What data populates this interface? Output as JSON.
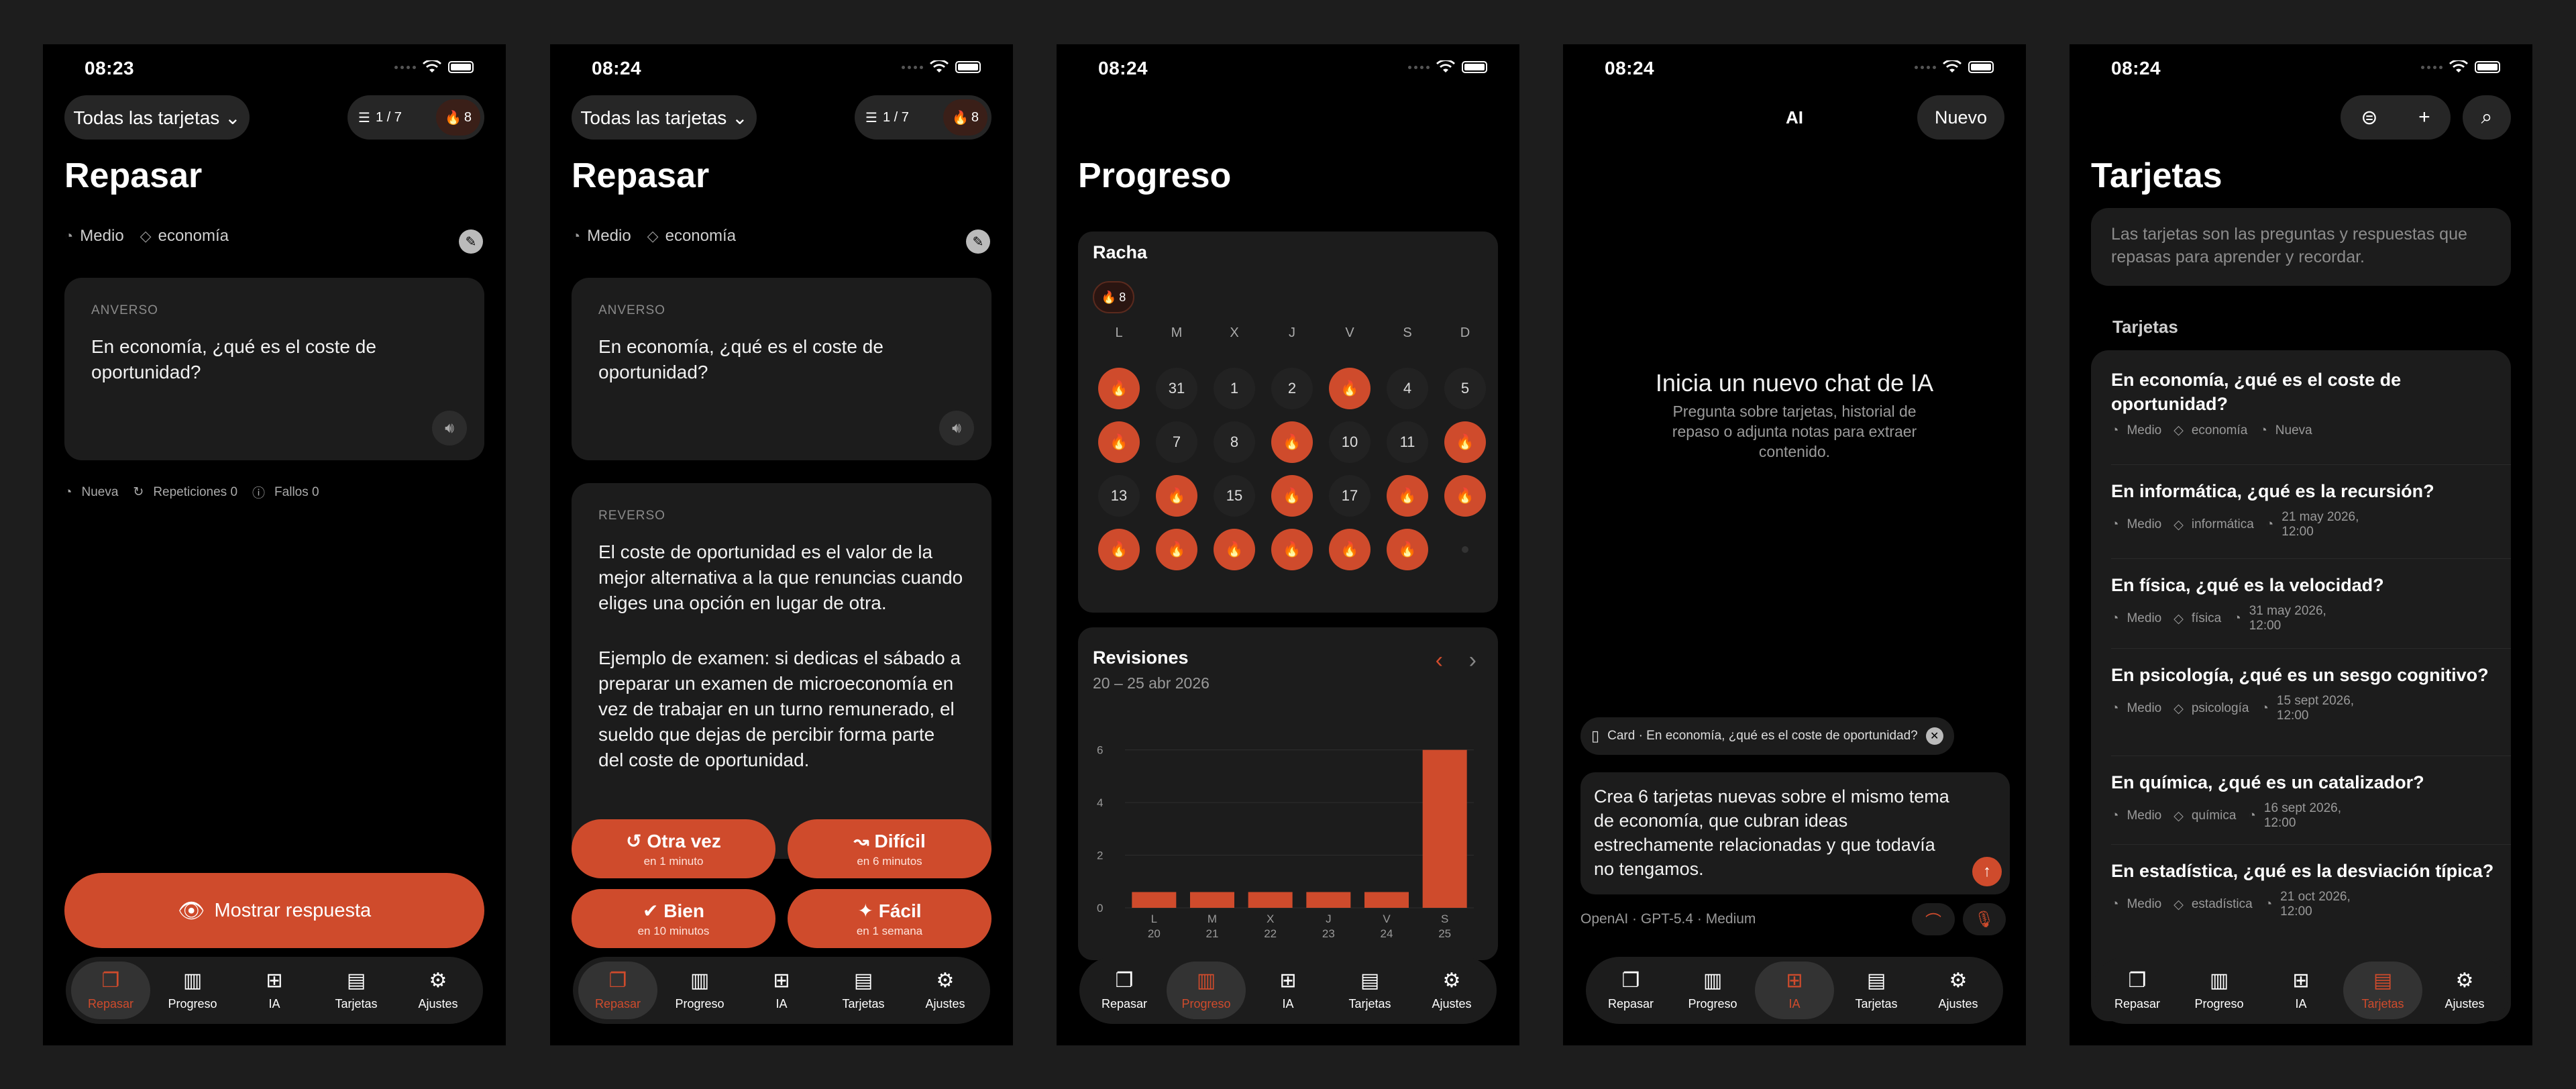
{
  "status": {
    "time1": "08:23",
    "time2": "08:24",
    "time3": "08:24",
    "time4": "08:24",
    "time5": "08:24"
  },
  "review": {
    "filter": "Todas las tarjetas ⌄",
    "count": "1 / 7",
    "streak": "8",
    "title": "Repasar",
    "difficulty": "Medio",
    "tag": "economía",
    "front_label": "ANVERSO",
    "question": "En economía, ¿qué es el coste de oportunidad?",
    "stats": {
      "state": "Nueva",
      "reps": "Repeticiones 0",
      "fails": "Fallos 0"
    },
    "show_answer": "Mostrar respuesta",
    "back_label": "REVERSO",
    "answer_p1": "El coste de oportunidad es el valor de la mejor alternativa a la que renuncias cuando eliges una opción en lugar de otra.",
    "answer_p2": "Ejemplo de examen: si dedicas el sábado a preparar un examen de microeconomía en vez de trabajar en un turno remunerado, el sueldo que dejas de percibir forma parte del coste de oportunidad.",
    "ai_badge": "AI",
    "buttons": [
      {
        "label": "Otra vez",
        "sub": "en 1 minuto",
        "icon": "↺"
      },
      {
        "label": "Difícil",
        "sub": "en 6 minutos",
        "icon": "↝"
      },
      {
        "label": "Bien",
        "sub": "en 10 minutos",
        "icon": "✔"
      },
      {
        "label": "Fácil",
        "sub": "en 1 semana",
        "icon": "✦"
      }
    ]
  },
  "progress": {
    "title": "Progreso",
    "streak_title": "Racha",
    "streak": "8",
    "weekdays": [
      "L",
      "M",
      "X",
      "J",
      "V",
      "S",
      "D"
    ],
    "weeks": [
      [
        {
          "d": "",
          "f": true
        },
        {
          "d": "31",
          "f": false
        },
        {
          "d": "1",
          "f": false
        },
        {
          "d": "2",
          "f": false
        },
        {
          "d": "",
          "f": true
        },
        {
          "d": "4",
          "f": false
        },
        {
          "d": "5",
          "f": false
        }
      ],
      [
        {
          "d": "",
          "f": true
        },
        {
          "d": "7",
          "f": false
        },
        {
          "d": "8",
          "f": false
        },
        {
          "d": "",
          "f": true
        },
        {
          "d": "10",
          "f": false
        },
        {
          "d": "11",
          "f": false
        },
        {
          "d": "",
          "f": true
        }
      ],
      [
        {
          "d": "13",
          "f": false
        },
        {
          "d": "",
          "f": true
        },
        {
          "d": "15",
          "f": false
        },
        {
          "d": "",
          "f": true
        },
        {
          "d": "17",
          "f": false
        },
        {
          "d": "",
          "f": true
        },
        {
          "d": "",
          "f": true
        }
      ],
      [
        {
          "d": "",
          "f": true
        },
        {
          "d": "",
          "f": true
        },
        {
          "d": "",
          "f": true
        },
        {
          "d": "",
          "f": true
        },
        {
          "d": "",
          "f": true
        },
        {
          "d": "",
          "f": true
        },
        {
          "d": "",
          "f": false
        }
      ]
    ],
    "revisions_title": "Revisiones",
    "range": "20 – 25 abr 2026"
  },
  "chart_data": {
    "type": "bar",
    "title": "Revisiones",
    "categories": [
      "L 20",
      "M 21",
      "X 22",
      "J 23",
      "V 24",
      "S 25"
    ],
    "x_letters": [
      "L",
      "M",
      "X",
      "J",
      "V",
      "S"
    ],
    "x_numbers": [
      "20",
      "21",
      "22",
      "23",
      "24",
      "25"
    ],
    "values": [
      0.6,
      0.6,
      0.6,
      0.6,
      0.6,
      6
    ],
    "yticks": [
      "0",
      "2",
      "4",
      "6"
    ],
    "ylim": [
      0,
      6.5
    ],
    "grid": true,
    "bar_color": "#cf4b2c"
  },
  "ai": {
    "title": "AI",
    "new_btn": "Nuevo",
    "empty_title": "Inicia un nuevo chat de IA",
    "empty_sub": "Pregunta sobre tarjetas, historial de repaso o adjunta notas para extraer contenido.",
    "context": "Card · En economía, ¿qué es el coste de oportunidad?",
    "message": "Crea 6 tarjetas nuevas sobre el mismo tema de economía, que cubran ideas estrechamente relacionadas y que todavía no tengamos.",
    "model": "OpenAI · GPT-5.4 · Medium"
  },
  "cards": {
    "title": "Tarjetas",
    "info": "Las tarjetas son las preguntas y respuestas que repasas para aprender y recordar.",
    "section": "Tarjetas",
    "items": [
      {
        "q": "En economía, ¿qué es el coste de oportunidad?",
        "level": "Medio",
        "tag": "economía",
        "due": "Nueva"
      },
      {
        "q": "En informática, ¿qué es la recursión?",
        "level": "Medio",
        "tag": "informática",
        "due": "21 may 2026, 12:00"
      },
      {
        "q": "En física, ¿qué es la velocidad?",
        "level": "Medio",
        "tag": "física",
        "due": "31 may 2026, 12:00"
      },
      {
        "q": "En psicología, ¿qué es un sesgo cognitivo?",
        "level": "Medio",
        "tag": "psicología",
        "due": "15 sept 2026, 12:00"
      },
      {
        "q": "En química, ¿qué es un catalizador?",
        "level": "Medio",
        "tag": "química",
        "due": "16 sept 2026, 12:00"
      },
      {
        "q": "En estadística, ¿qué es la desviación típica?",
        "level": "Medio",
        "tag": "estadística",
        "due": "21 oct 2026, 12:00"
      }
    ]
  },
  "tabs": [
    {
      "label": "Repasar",
      "icon": "❐"
    },
    {
      "label": "Progreso",
      "icon": "▥"
    },
    {
      "label": "IA",
      "icon": "⊞"
    },
    {
      "label": "Tarjetas",
      "icon": "▤"
    },
    {
      "label": "Ajustes",
      "icon": "⚙"
    }
  ],
  "colors": {
    "accent": "#cf4b2c",
    "card": "#1c1c1c",
    "bg": "#000000"
  }
}
